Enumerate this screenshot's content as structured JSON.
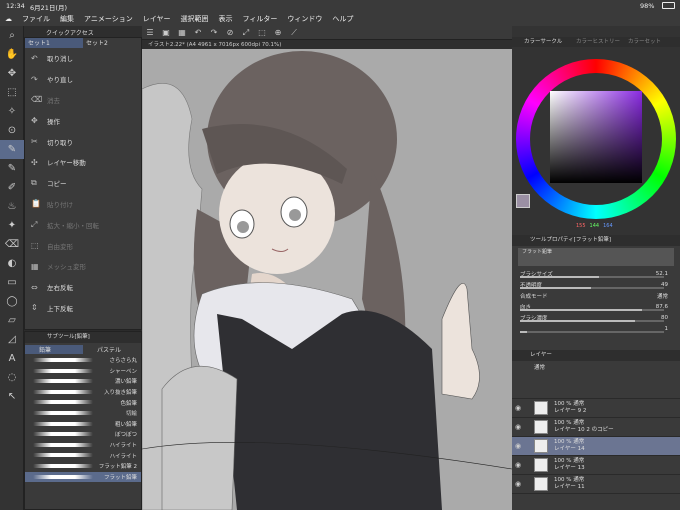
{
  "status": {
    "time": "12:34",
    "date": "6月21日(月)",
    "battery": "98%"
  },
  "menu": [
    "ファイル",
    "編集",
    "アニメーション",
    "レイヤー",
    "選択範囲",
    "表示",
    "フィルター",
    "ウィンドウ",
    "ヘルプ"
  ],
  "quick_access": {
    "title": "クイックアクセス",
    "tabs": [
      "セット1",
      "セット2"
    ],
    "items": [
      {
        "label": "取り消し",
        "enabled": true,
        "icon": "↶"
      },
      {
        "label": "やり直し",
        "enabled": true,
        "icon": "↷"
      },
      {
        "label": "消去",
        "enabled": false,
        "icon": "⌫"
      },
      {
        "label": "操作",
        "enabled": true,
        "icon": "✥"
      },
      {
        "label": "切り取り",
        "enabled": true,
        "icon": "✂"
      },
      {
        "label": "レイヤー移動",
        "enabled": true,
        "icon": "✣"
      },
      {
        "label": "コピー",
        "enabled": true,
        "icon": "⧉"
      },
      {
        "label": "貼り付け",
        "enabled": false,
        "icon": "📋"
      },
      {
        "label": "拡大・縮小・回転",
        "enabled": false,
        "icon": "⤢"
      },
      {
        "label": "自由変形",
        "enabled": false,
        "icon": "⬚"
      },
      {
        "label": "メッシュ変形",
        "enabled": false,
        "icon": "▦"
      },
      {
        "label": "左右反転",
        "enabled": true,
        "icon": "⇔"
      },
      {
        "label": "上下反転",
        "enabled": true,
        "icon": "⇕"
      }
    ]
  },
  "subtool": {
    "title": "サブツール[鉛筆]",
    "tabs": [
      "鉛筆",
      "パステル"
    ],
    "brushes": [
      "さらさら丸",
      "シャーペン",
      "濃い鉛筆",
      "入り抜き鉛筆",
      "色鉛筆",
      "切絵",
      "粗い鉛筆",
      "ぼつぼつ",
      "ハイライト",
      "ハイライト",
      "フラット鉛筆 2",
      "フラット鉛筆"
    ],
    "selected_index": 11
  },
  "document": {
    "title": "イラスト2.22* (A4 4961 x 7016px 600dpi 70.1%)"
  },
  "color": {
    "tabs": [
      "カラーサークル",
      "カラーヒストリー",
      "カラーセット"
    ],
    "rgb": [
      "155",
      "144",
      "164"
    ]
  },
  "tool_property": {
    "title": "ツールプロパティ[フラット鉛筆]",
    "brush_name": "フラット鉛筆",
    "props": [
      {
        "label": "ブラシサイズ",
        "value": "52.1",
        "frac": 0.55
      },
      {
        "label": "不透明度",
        "value": "49",
        "frac": 0.49
      },
      {
        "label": "合成モード",
        "value": "通常",
        "frac": null
      },
      {
        "label": "向き",
        "value": "87.6",
        "frac": 0.85
      },
      {
        "label": "ブラシ濃度",
        "value": "80",
        "frac": 0.8
      },
      {
        "label": "",
        "value": "1",
        "frac": 0.05
      }
    ]
  },
  "layers": {
    "title": "レイヤー",
    "blend": "通常",
    "items": [
      {
        "pct": "100 % 通常",
        "name": "レイヤー 9 2",
        "visible": true,
        "selected": false
      },
      {
        "pct": "100 % 通常",
        "name": "レイヤー 10 2 のコピー",
        "visible": true,
        "selected": false
      },
      {
        "pct": "100 % 通常",
        "name": "レイヤー 14",
        "visible": true,
        "selected": true
      },
      {
        "pct": "100 % 通常",
        "name": "レイヤー 13",
        "visible": true,
        "selected": false
      },
      {
        "pct": "100 % 通常",
        "name": "レイヤー 11",
        "visible": true,
        "selected": false
      }
    ]
  }
}
